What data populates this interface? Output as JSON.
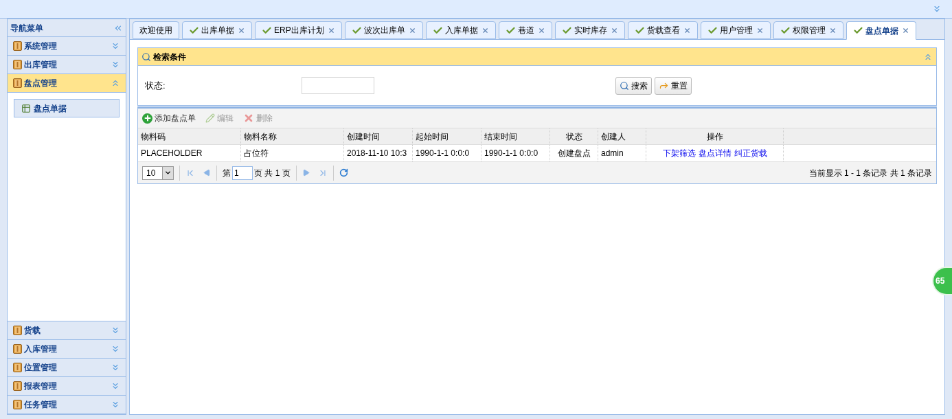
{
  "sidebar": {
    "title": "导航菜单",
    "groups": [
      {
        "label": "系统管理",
        "expanded": false
      },
      {
        "label": "出库管理",
        "expanded": false
      },
      {
        "label": "盘点管理",
        "expanded": true,
        "children": [
          {
            "label": "盘点单据",
            "selected": true
          }
        ]
      },
      {
        "label": "货载",
        "expanded": false
      },
      {
        "label": "入库管理",
        "expanded": false
      },
      {
        "label": "位置管理",
        "expanded": false
      },
      {
        "label": "报表管理",
        "expanded": false
      },
      {
        "label": "任务管理",
        "expanded": false
      }
    ]
  },
  "tabs": [
    {
      "label": "欢迎使用",
      "closable": false,
      "selected": false
    },
    {
      "label": "出库单据",
      "closable": true,
      "selected": false
    },
    {
      "label": "ERP出库计划",
      "closable": true,
      "selected": false
    },
    {
      "label": "波次出库单",
      "closable": true,
      "selected": false
    },
    {
      "label": "入库单据",
      "closable": true,
      "selected": false
    },
    {
      "label": "巷道",
      "closable": true,
      "selected": false
    },
    {
      "label": "实时库存",
      "closable": true,
      "selected": false
    },
    {
      "label": "货载查看",
      "closable": true,
      "selected": false
    },
    {
      "label": "用户管理",
      "closable": true,
      "selected": false
    },
    {
      "label": "权限管理",
      "closable": true,
      "selected": false
    },
    {
      "label": "盘点单据",
      "closable": true,
      "selected": true
    }
  ],
  "search_panel": {
    "title": "检索条件",
    "expanded": true,
    "fields": [
      {
        "label": "状态:"
      }
    ],
    "buttons": [
      {
        "label": "搜索",
        "kind": "search"
      },
      {
        "label": "重置",
        "kind": "reset"
      }
    ]
  },
  "toolbar": [
    {
      "label": "添加盘点单",
      "kind": "add",
      "disabled": false
    },
    {
      "label": "编辑",
      "kind": "edit",
      "disabled": true
    },
    {
      "label": "删除",
      "kind": "delete",
      "disabled": true
    }
  ],
  "table": {
    "columns": [
      "物料码",
      "物料名称",
      "创建时间",
      "起始时间",
      "结束时间",
      "状态",
      "创建人",
      "操作"
    ],
    "rows": [
      {
        "cells": [
          "PLACEHOLDER",
          "占位符",
          "2018-11-10 10:3",
          "1990-1-1 0:0:0",
          "1990-1-1 0:0:0",
          "创建盘点",
          "admin"
        ],
        "actions": [
          "下架筛选",
          "盘点详情",
          "纠正货载"
        ]
      }
    ]
  },
  "pager": {
    "page_size": "10",
    "page_prefix": "第",
    "page": "1",
    "page_suffix": "页 共 1 页",
    "summary": "当前显示 1 - 1 条记录 共 1 条记录"
  },
  "badge": "65"
}
